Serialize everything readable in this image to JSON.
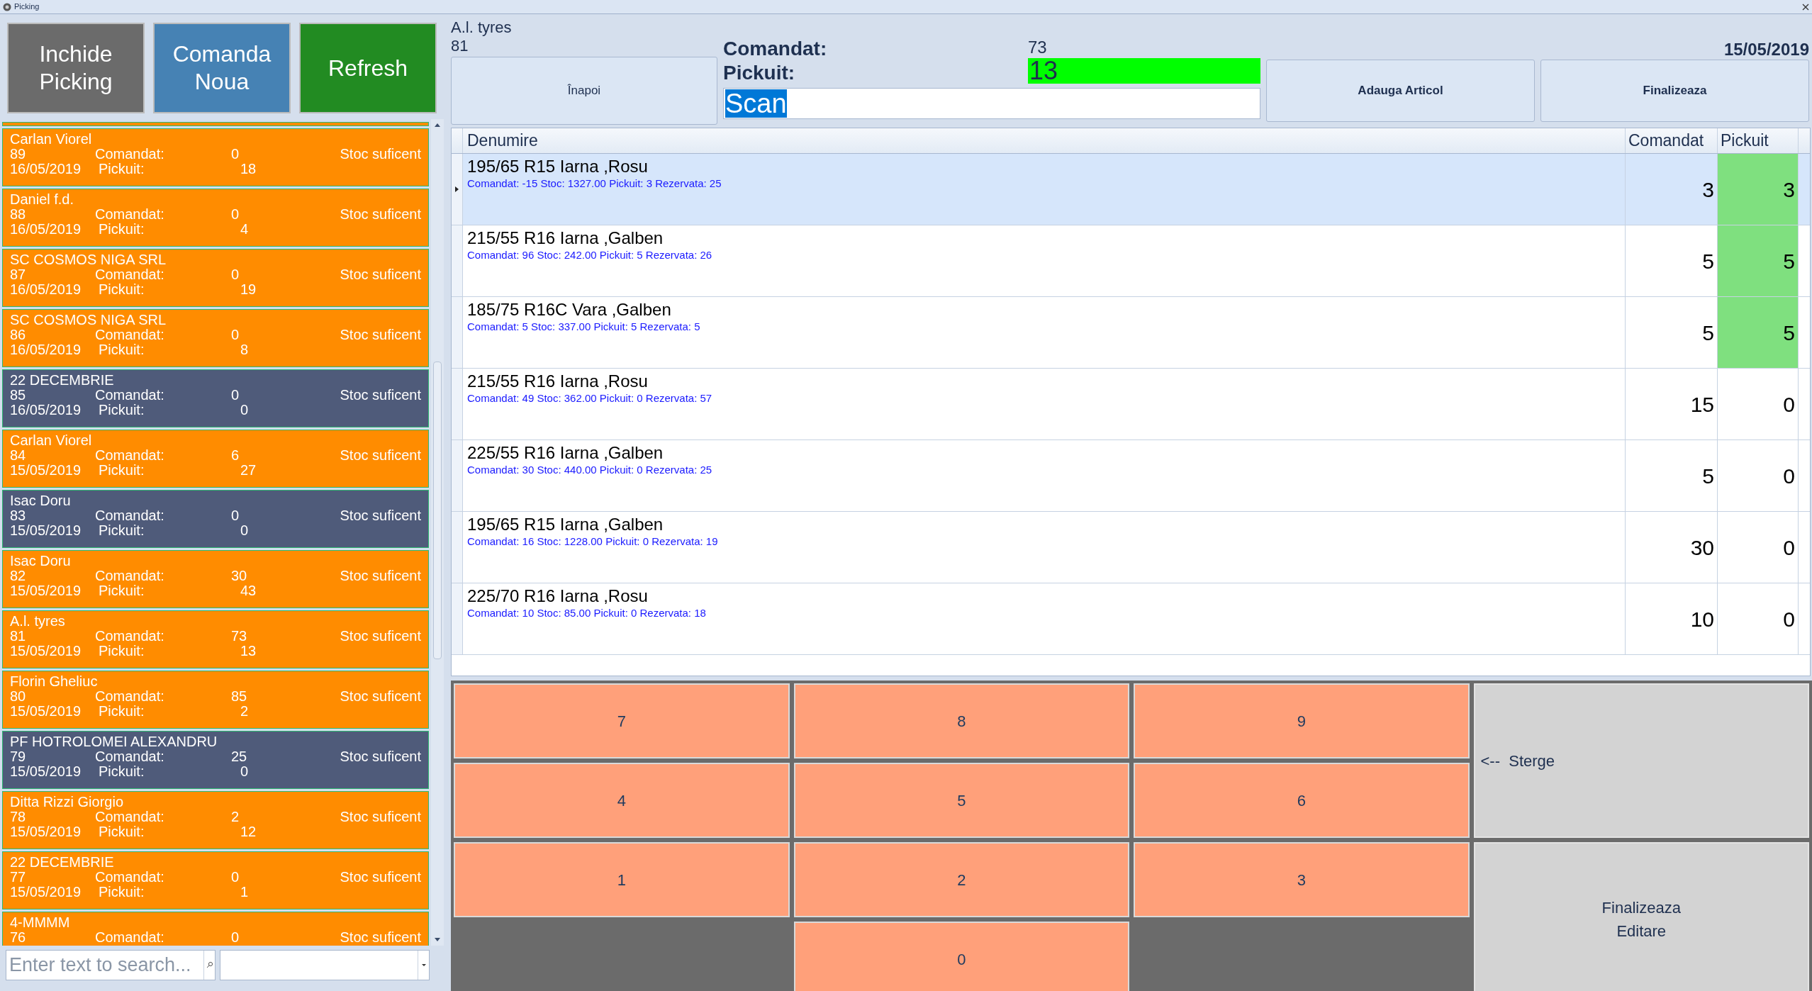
{
  "window": {
    "title": "Picking"
  },
  "toolbar": [
    {
      "label": "Inchide Picking",
      "kind": "close"
    },
    {
      "label": "Comanda Noua",
      "kind": "new"
    },
    {
      "label": "Refresh",
      "kind": "refresh"
    }
  ],
  "orders": [
    {
      "name": "Carlan Viorel",
      "number": "89",
      "date": "16/05/2019",
      "ordered_label": "Comandat:",
      "ordered": "0",
      "picked_label": "Pickuit:",
      "picked": "18",
      "status": "Stoc suficent",
      "color": "#ff8c00"
    },
    {
      "name": "Daniel f.d.",
      "number": "88",
      "date": "16/05/2019",
      "ordered_label": "Comandat:",
      "ordered": "0",
      "picked_label": "Pickuit:",
      "picked": "4",
      "status": "Stoc suficent",
      "color": "#ff8c00"
    },
    {
      "name": "SC COSMOS NIGA SRL",
      "number": "87",
      "date": "16/05/2019",
      "ordered_label": "Comandat:",
      "ordered": "0",
      "picked_label": "Pickuit:",
      "picked": "19",
      "status": "Stoc suficent",
      "color": "#ff8c00"
    },
    {
      "name": "SC COSMOS NIGA SRL",
      "number": "86",
      "date": "16/05/2019",
      "ordered_label": "Comandat:",
      "ordered": "0",
      "picked_label": "Pickuit:",
      "picked": "8",
      "status": "Stoc suficent",
      "color": "#ff8c00"
    },
    {
      "name": "22 DECEMBRIE",
      "number": "85",
      "date": "16/05/2019",
      "ordered_label": "Comandat:",
      "ordered": "0",
      "picked_label": "Pickuit:",
      "picked": "0",
      "status": "Stoc suficent",
      "color": "#4f5b7a"
    },
    {
      "name": "Carlan Viorel",
      "number": "84",
      "date": "15/05/2019",
      "ordered_label": "Comandat:",
      "ordered": "6",
      "picked_label": "Pickuit:",
      "picked": "27",
      "status": "Stoc suficent",
      "color": "#ff8c00"
    },
    {
      "name": "Isac Doru",
      "number": "83",
      "date": "15/05/2019",
      "ordered_label": "Comandat:",
      "ordered": "0",
      "picked_label": "Pickuit:",
      "picked": "0",
      "status": "Stoc suficent",
      "color": "#4f5b7a"
    },
    {
      "name": "Isac Doru",
      "number": "82",
      "date": "15/05/2019",
      "ordered_label": "Comandat:",
      "ordered": "30",
      "picked_label": "Pickuit:",
      "picked": "43",
      "status": "Stoc suficent",
      "color": "#ff8c00"
    },
    {
      "name": "A.l. tyres",
      "number": "81",
      "date": "15/05/2019",
      "ordered_label": "Comandat:",
      "ordered": "73",
      "picked_label": "Pickuit:",
      "picked": "13",
      "status": "Stoc suficent",
      "color": "#ff8c00"
    },
    {
      "name": "Florin Gheliuc",
      "number": "80",
      "date": "15/05/2019",
      "ordered_label": "Comandat:",
      "ordered": "85",
      "picked_label": "Pickuit:",
      "picked": "2",
      "status": "Stoc suficent",
      "color": "#ff8c00"
    },
    {
      "name": "PF HOTROLOMEI ALEXANDRU",
      "number": "79",
      "date": "15/05/2019",
      "ordered_label": "Comandat:",
      "ordered": "25",
      "picked_label": "Pickuit:",
      "picked": "0",
      "status": "Stoc suficent",
      "color": "#4f5b7a"
    },
    {
      "name": "Ditta Rizzi Giorgio",
      "number": "78",
      "date": "15/05/2019",
      "ordered_label": "Comandat:",
      "ordered": "2",
      "picked_label": "Pickuit:",
      "picked": "12",
      "status": "Stoc suficent",
      "color": "#ff8c00"
    },
    {
      "name": "22 DECEMBRIE",
      "number": "77",
      "date": "15/05/2019",
      "ordered_label": "Comandat:",
      "ordered": "0",
      "picked_label": "Pickuit:",
      "picked": "1",
      "status": "Stoc suficent",
      "color": "#ff8c00"
    },
    {
      "name": "4-MMMM",
      "number": "76",
      "ordered_label": "Comandat:",
      "ordered": "0",
      "status": "Stoc suficent",
      "color": "#ff8c00"
    }
  ],
  "search": {
    "placeholder": "Enter text to search..."
  },
  "header": {
    "customer": "A.l. tyres",
    "number": "81",
    "back_button": "Înapoi",
    "ordered_label": "Comandat:",
    "ordered": "73",
    "picked_label": "Pickuit:",
    "picked": "13",
    "scan_value": "Scan",
    "add_button": "Adauga Articol",
    "finish_button": "Finalizeaza",
    "date": "15/05/2019"
  },
  "table": {
    "columns": [
      "Denumire",
      "Comandat",
      "Pickuit"
    ],
    "rows": [
      {
        "name": "195/65 R15 Iarna ,Rosu",
        "details": "Comandat: -15 Stoc: 1327.00 Pickuit: 3 Rezervata: 25",
        "ordered": "3",
        "picked": "3",
        "selected": true,
        "complete": true
      },
      {
        "name": "215/55 R16 Iarna ,Galben",
        "details": "Comandat: 96 Stoc: 242.00 Pickuit: 5 Rezervata: 26",
        "ordered": "5",
        "picked": "5",
        "selected": false,
        "complete": true
      },
      {
        "name": "185/75 R16C Vara ,Galben",
        "details": "Comandat: 5 Stoc: 337.00 Pickuit: 5 Rezervata: 5",
        "ordered": "5",
        "picked": "5",
        "selected": false,
        "complete": true
      },
      {
        "name": "215/55 R16 Iarna ,Rosu",
        "details": "Comandat: 49 Stoc: 362.00 Pickuit: 0 Rezervata: 57",
        "ordered": "15",
        "picked": "0",
        "selected": false,
        "complete": false
      },
      {
        "name": "225/55 R16 Iarna ,Galben",
        "details": "Comandat: 30 Stoc: 440.00 Pickuit: 0 Rezervata: 25",
        "ordered": "5",
        "picked": "0",
        "selected": false,
        "complete": false
      },
      {
        "name": "195/65 R15 Iarna ,Galben",
        "details": "Comandat: 16 Stoc: 1228.00 Pickuit: 0 Rezervata: 19",
        "ordered": "30",
        "picked": "0",
        "selected": false,
        "complete": false
      },
      {
        "name": "225/70 R16 Iarna ,Rosu",
        "details": "Comandat: 10 Stoc: 85.00 Pickuit: 0 Rezervata: 18",
        "ordered": "10",
        "picked": "0",
        "selected": false,
        "complete": false
      }
    ]
  },
  "keypad": {
    "digit_rows": [
      [
        "7",
        "8",
        "9"
      ],
      [
        "4",
        "5",
        "6"
      ],
      [
        "1",
        "2",
        "3"
      ],
      [
        "0"
      ]
    ],
    "delete_button": "<--  Sterge",
    "finish_edit_button": "Finalizeaza Editare"
  }
}
